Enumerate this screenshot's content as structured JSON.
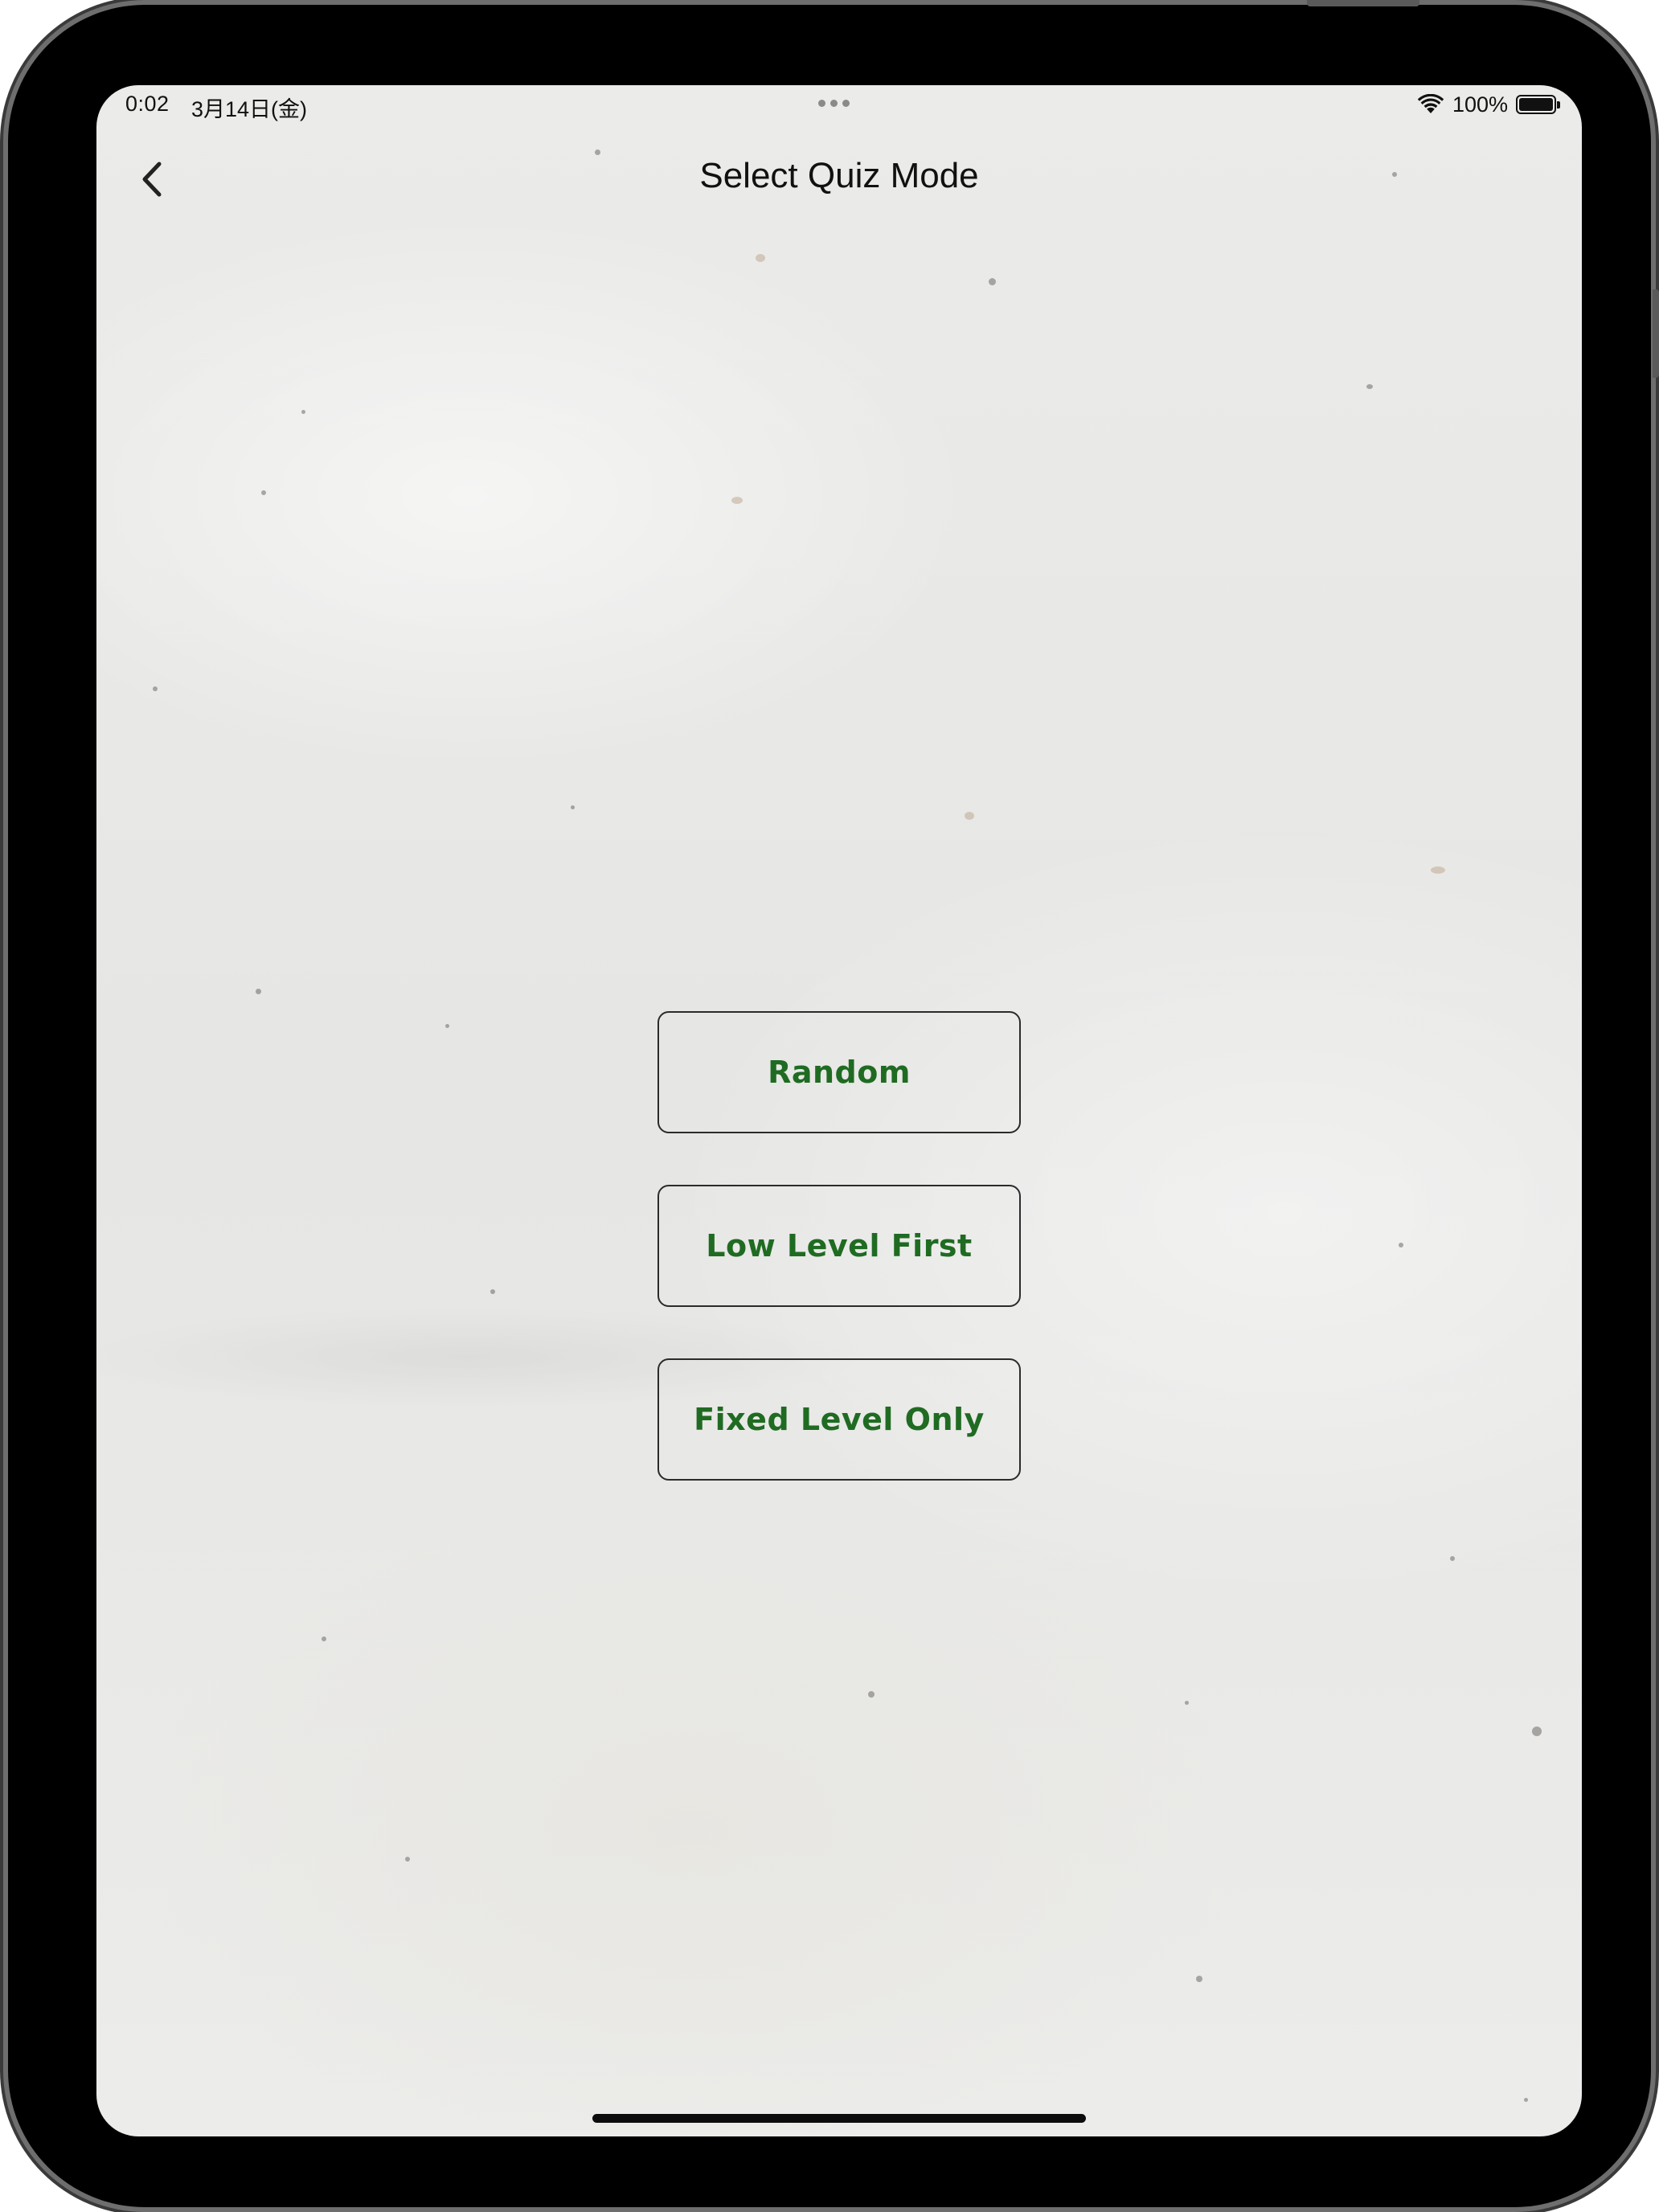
{
  "status_bar": {
    "time": "0:02",
    "date": "3月14日(金)",
    "battery": "100%",
    "icons": [
      "wifi-icon",
      "battery-icon"
    ]
  },
  "nav": {
    "title": "Select Quiz Mode",
    "back_icon": "chevron-left-icon"
  },
  "modes": [
    {
      "label": "Random"
    },
    {
      "label": "Low Level First"
    },
    {
      "label": "Fixed Level Only"
    }
  ],
  "colors": {
    "button_text": "#1f6b22",
    "button_border": "#2b2b2b",
    "background": "#e9e9e7"
  }
}
